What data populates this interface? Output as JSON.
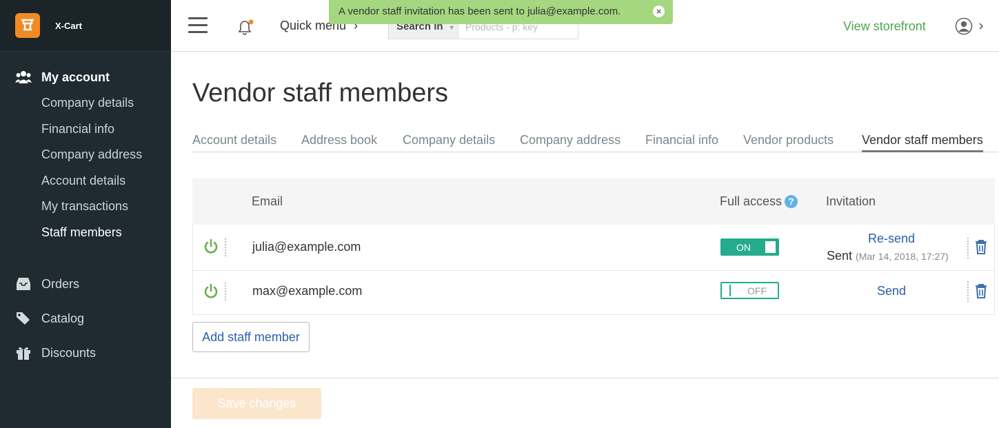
{
  "app": {
    "name": "X-Cart"
  },
  "notice": {
    "text": "A vendor staff invitation has been sent to julia@example.com.",
    "close": "×"
  },
  "sidebar": {
    "account_heading": "My account",
    "account_items": [
      "Company details",
      "Financial info",
      "Company address",
      "Account details",
      "My transactions",
      "Staff members"
    ],
    "active_item": "Staff members",
    "main_items": [
      {
        "label": "Orders",
        "icon": "inbox-icon"
      },
      {
        "label": "Catalog",
        "icon": "tag-icon"
      },
      {
        "label": "Discounts",
        "icon": "gift-icon"
      }
    ]
  },
  "header": {
    "quick_menu": "Quick menu",
    "search_in": "Search in",
    "search_placeholder": "Products - p: key",
    "view_storefront": "View storefront"
  },
  "page": {
    "title": "Vendor staff members",
    "tabs": [
      "Account details",
      "Address book",
      "Company details",
      "Company address",
      "Financial info",
      "Vendor products",
      "Vendor staff members"
    ],
    "active_tab": "Vendor staff members"
  },
  "table": {
    "headers": {
      "email": "Email",
      "full_access": "Full access",
      "help": "?",
      "invitation": "Invitation"
    },
    "rows": [
      {
        "email": "julia@example.com",
        "full_access": "ON",
        "action": "Re-send",
        "status": "Sent",
        "status_date": "(Mar 14, 2018, 17:27)"
      },
      {
        "email": "max@example.com",
        "full_access": "OFF",
        "action": "Send"
      }
    ]
  },
  "buttons": {
    "add_staff": "Add staff member",
    "save": "Save changes"
  },
  "colors": {
    "sidebar_bg": "#1f2b31",
    "accent_green": "#25ab8e",
    "link_blue": "#2b5fa8",
    "notice_bg": "#a4d77f",
    "logo_orange": "#f18a25"
  }
}
